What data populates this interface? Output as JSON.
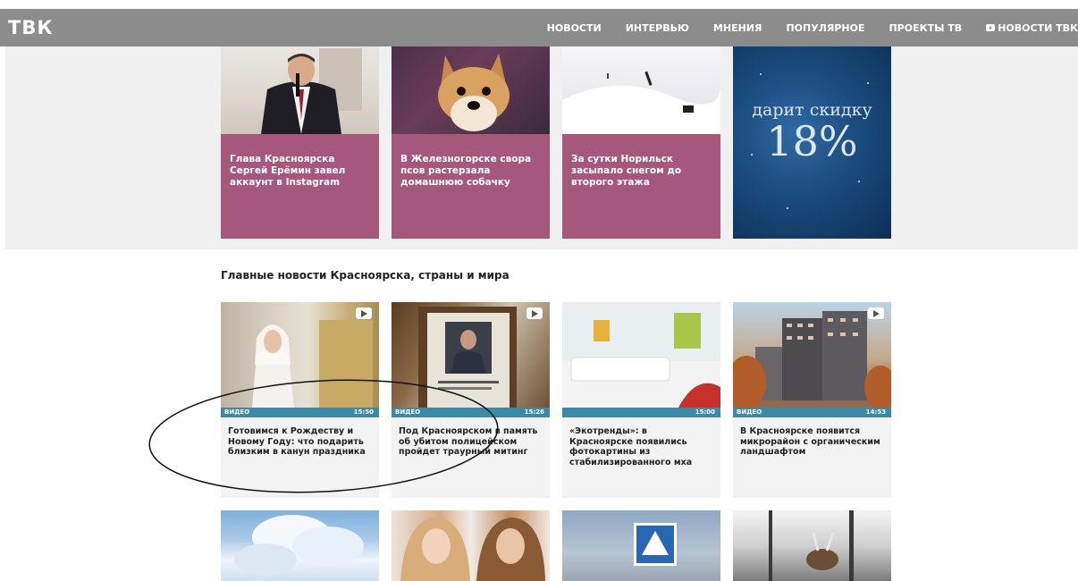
{
  "header": {
    "logo": "ТВК",
    "nav": [
      {
        "label": "НОВОСТИ"
      },
      {
        "label": "ИНТЕРВЬЮ"
      },
      {
        "label": "МНЕНИЯ"
      },
      {
        "label": "ПОПУЛЯРНОЕ"
      },
      {
        "label": "ПРОЕКТЫ ТВ"
      },
      {
        "label": "НОВОСТИ ТВК",
        "icon": "youtube-icon"
      }
    ]
  },
  "top_cards": [
    {
      "title": "Глава Красноярска Сергей Ерёмин завел аккаунт в Instagram"
    },
    {
      "title": "В Железногорске свора псов растерзала домашнюю собачку"
    },
    {
      "title": "За сутки Норильск засыпало снегом до второго этажа"
    }
  ],
  "ad": {
    "line1": "дарит скидку",
    "line2": "18%"
  },
  "section": {
    "title": "Главные новости Красноярска, страны и мира"
  },
  "news": [
    {
      "tag": "ВИДЕО",
      "time": "15:50",
      "title": "Готовимся к Рождеству и Новому Году: что подарить близким в канун праздника"
    },
    {
      "tag": "ВИДЕО",
      "time": "15:26",
      "title": "Под Красноярском в память об убитом полицейском пройдет траурный митинг"
    },
    {
      "tag": "",
      "time": "15:00",
      "title": "«Экотренды»: в Красноярске появились фотокартины из стабилизированного мха"
    },
    {
      "tag": "ВИДЕО",
      "time": "14:53",
      "title": "В Красноярске появится микрорайон с органическим ландшафтом"
    }
  ],
  "colors": {
    "header_bg": "#8c8c8c",
    "card_caption_bg": "#a5587a",
    "video_strip_bg": "#3b8aa8"
  }
}
